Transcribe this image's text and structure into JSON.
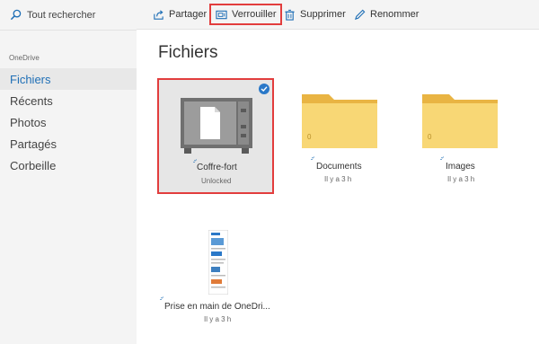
{
  "search": {
    "placeholder_text": "Tout rechercher",
    "icon": "search-icon"
  },
  "sidebar": {
    "section_label": "OneDrive",
    "items": [
      {
        "label": "Fichiers",
        "active": true
      },
      {
        "label": "Récents",
        "active": false
      },
      {
        "label": "Photos",
        "active": false
      },
      {
        "label": "Partagés",
        "active": false
      },
      {
        "label": "Corbeille",
        "active": false
      }
    ]
  },
  "toolbar": {
    "share_label": "Partager",
    "lock_label": "Verrouiller",
    "delete_label": "Supprimer",
    "rename_label": "Renommer"
  },
  "main": {
    "title": "Fichiers",
    "items": [
      {
        "name": "Coffre-fort",
        "sub": "Unlocked",
        "kind": "vault",
        "selected": true
      },
      {
        "name": "Documents",
        "sub": "Il y a 3 h",
        "kind": "folder",
        "count": "0"
      },
      {
        "name": "Images",
        "sub": "Il y a 3 h",
        "kind": "folder",
        "count": "0"
      },
      {
        "name": "Prise en main de OneDri...",
        "sub": "Il y a 3 h",
        "kind": "document"
      }
    ]
  },
  "colors": {
    "accent": "#1f6fb6",
    "highlight": "#e23d3d",
    "folder": "#f8d775",
    "folder_back": "#e9b443",
    "check": "#2a78c8"
  }
}
